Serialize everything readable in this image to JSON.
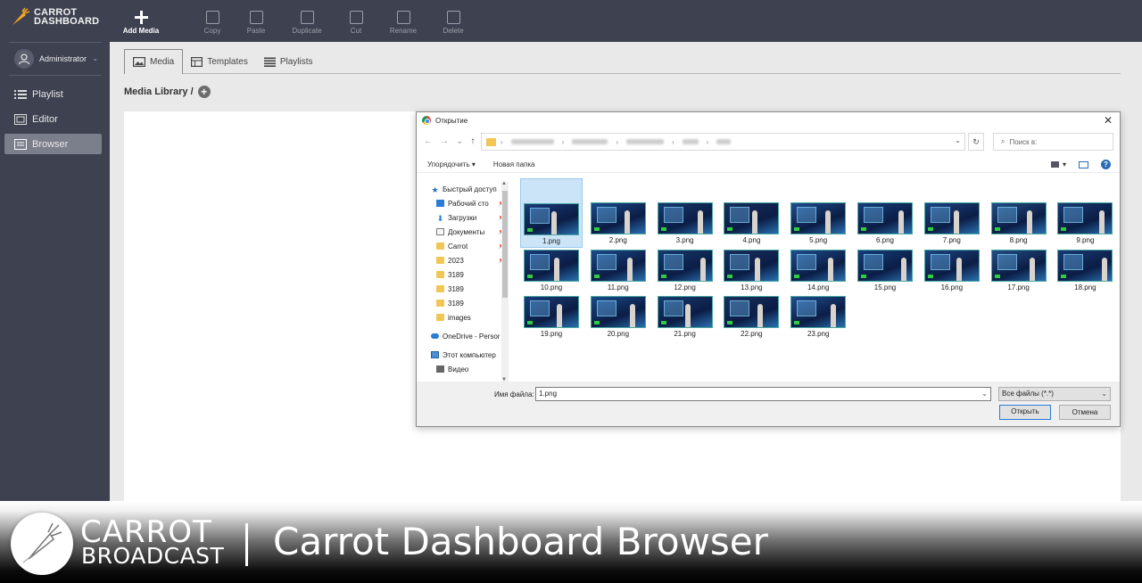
{
  "app": {
    "logo_line1": "CARROT",
    "logo_line2": "DASHBOARD"
  },
  "user": {
    "name": "Administrator"
  },
  "sidebar": {
    "items": [
      {
        "label": "Playlist",
        "icon": "list-icon",
        "active": false
      },
      {
        "label": "Editor",
        "icon": "editor-icon",
        "active": false
      },
      {
        "label": "Browser",
        "icon": "browser-icon",
        "active": true
      }
    ]
  },
  "toolbar": {
    "add_label": "Add Media",
    "copy_label": "Copy",
    "paste_label": "Paste",
    "duplicate_label": "Duplicate",
    "cut_label": "Cut",
    "rename_label": "Rename",
    "delete_label": "Delete"
  },
  "tabs": [
    {
      "label": "Media",
      "active": true
    },
    {
      "label": "Templates",
      "active": false
    },
    {
      "label": "Playlists",
      "active": false
    }
  ],
  "breadcrumb": {
    "label": "Media Library /"
  },
  "dialog": {
    "title": "Открытие",
    "search_placeholder": "Поиск в:",
    "organize_label": "Упорядочить",
    "new_folder_label": "Новая папка",
    "tree": [
      {
        "label": "Быстрый доступ",
        "icon": "star-icon",
        "top": true
      },
      {
        "label": "Рабочий сто",
        "icon": "desktop-icon",
        "pin": true
      },
      {
        "label": "Загрузки",
        "icon": "download-icon",
        "pin": true
      },
      {
        "label": "Документы",
        "icon": "documents-icon",
        "pin": true
      },
      {
        "label": "Carrot",
        "icon": "folder-icon",
        "pin": true
      },
      {
        "label": "2023",
        "icon": "folder-icon",
        "pin": true
      },
      {
        "label": "3189",
        "icon": "folder-icon"
      },
      {
        "label": "3189",
        "icon": "folder-icon"
      },
      {
        "label": "3189",
        "icon": "folder-icon"
      },
      {
        "label": "images",
        "icon": "folder-icon"
      },
      {
        "label": "OneDrive - Persor",
        "icon": "cloud-icon",
        "top": true,
        "gap": true
      },
      {
        "label": "Этот компьютер",
        "icon": "computer-icon",
        "top": true,
        "gap": true
      },
      {
        "label": "Видео",
        "icon": "video-icon"
      }
    ],
    "files": [
      "1.png",
      "2.png",
      "3.png",
      "4.png",
      "5.png",
      "6.png",
      "7.png",
      "8.png",
      "9.png",
      "10.png",
      "11.png",
      "12.png",
      "13.png",
      "14.png",
      "15.png",
      "16.png",
      "17.png",
      "18.png",
      "19.png",
      "20.png",
      "21.png",
      "22.png",
      "23.png"
    ],
    "selected_file": "1.png",
    "filename_label": "Имя файла:",
    "filename_value": "1.png",
    "filetype_value": "Все файлы (*.*)",
    "open_label": "Открыть",
    "cancel_label": "Отмена"
  },
  "banner": {
    "brand_line1": "CARROT",
    "brand_line2": "BROADCAST",
    "title": "Carrot Dashboard Browser"
  },
  "colors": {
    "sidebar_bg": "#3d4150",
    "active_nav": "#7b7f8b",
    "accent_blue": "#2a7bd6"
  }
}
